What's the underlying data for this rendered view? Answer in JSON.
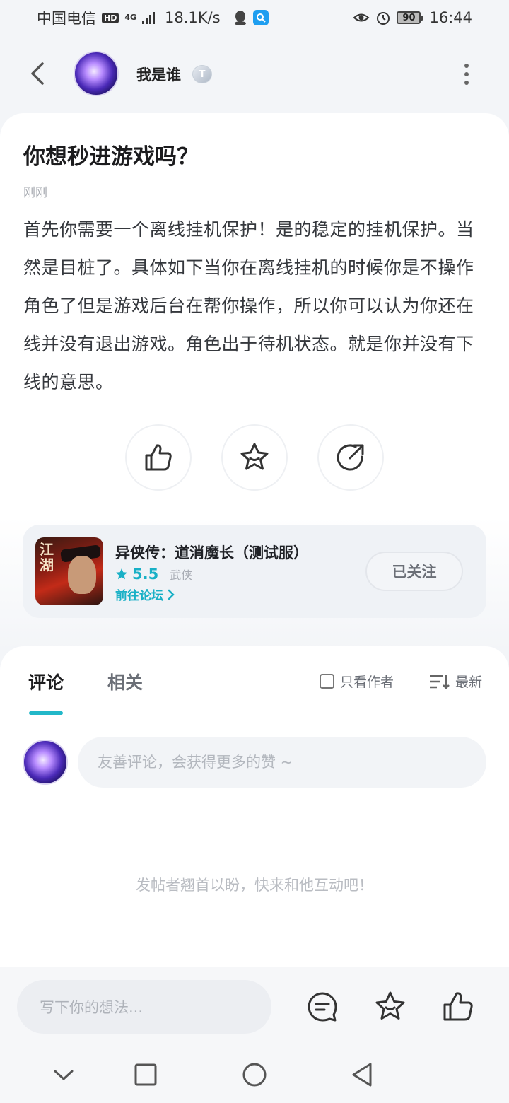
{
  "status_bar": {
    "carrier": "中国电信",
    "hd": "HD",
    "net_type": "4G",
    "speed": "18.1K/s",
    "battery": "90",
    "time": "16:44"
  },
  "header": {
    "author_name": "我是谁",
    "level_badge": "T"
  },
  "post": {
    "title": "你想秒进游戏吗？",
    "time": "刚刚",
    "body": "首先你需要一个离线挂机保护！是的稳定的挂机保护。当然是目桩了。具体如下当你在离线挂机的时候你是不操作角色了但是游戏后台在帮你操作，所以你可以认为你还在线并没有退出游戏。角色出于待机状态。就是你并没有下线的意思。"
  },
  "game": {
    "title": "异侠传：道消魔长（测试服）",
    "rating": "5.5",
    "category": "武侠",
    "forum_link": "前往论坛",
    "follow_label": "已关注",
    "icon_text": "江湖"
  },
  "comments": {
    "tab_comments": "评论",
    "tab_related": "相关",
    "author_only": "只看作者",
    "sort": "最新",
    "input_placeholder": "友善评论，会获得更多的赞 ~",
    "empty_note": "发帖者翘首以盼，快来和他互动吧！"
  },
  "bottom_bar": {
    "write_placeholder": "写下你的想法..."
  },
  "colors": {
    "accent": "#22b8c9",
    "rating": "#18b0c6"
  }
}
